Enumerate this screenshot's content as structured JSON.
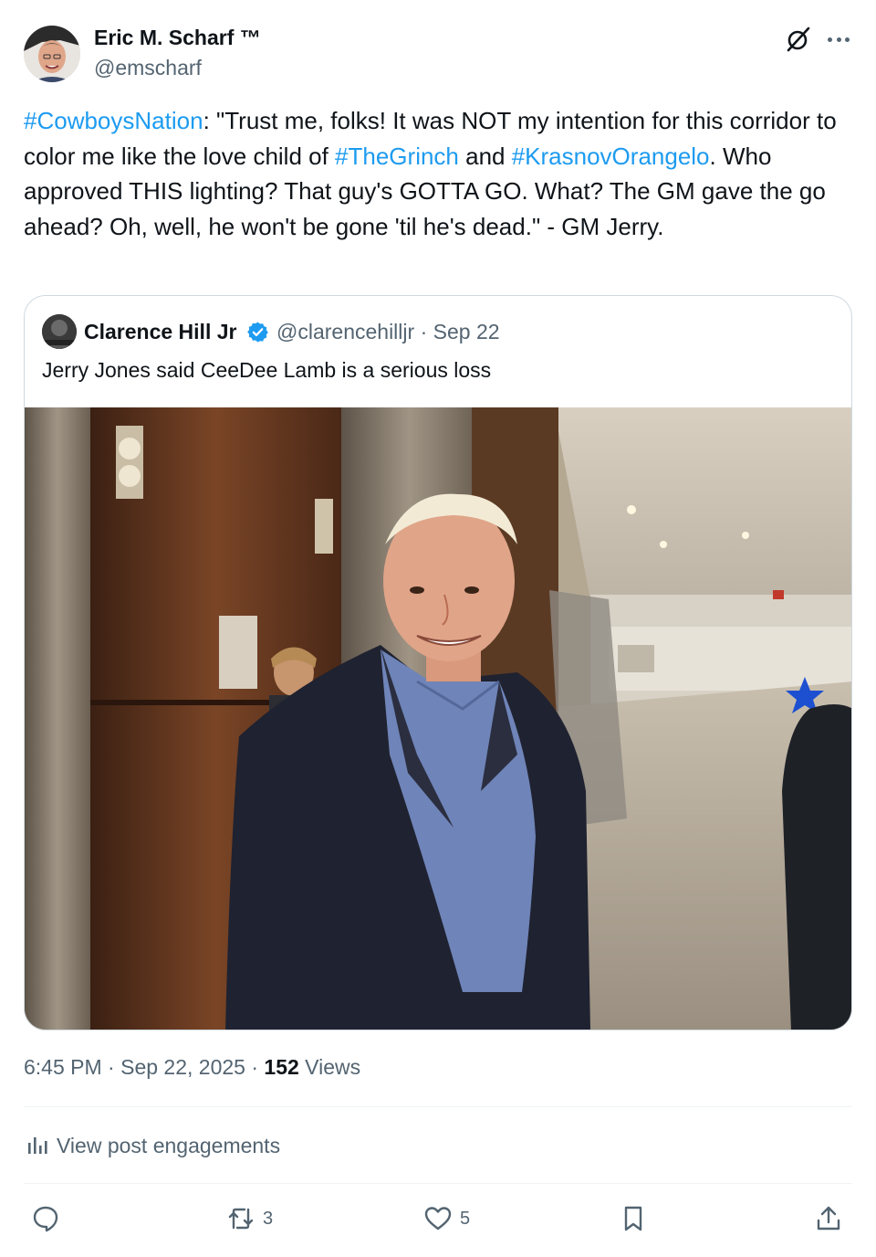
{
  "author": {
    "name": "Eric M. Scharf ™",
    "handle": "@emscharf",
    "icons": {
      "grok": "grok-slash-icon",
      "more": "more-dots-icon"
    }
  },
  "tweet": {
    "segments": [
      {
        "text": "#CowboysNation",
        "tag": true
      },
      {
        "text": ": \"Trust me, folks! It was NOT my intention for this corridor to color me like the love child of ",
        "tag": false
      },
      {
        "text": "#TheGrinch",
        "tag": true
      },
      {
        "text": " and ",
        "tag": false
      },
      {
        "text": "#KrasnovOrangelo",
        "tag": true
      },
      {
        "text": ". Who approved THIS lighting? That guy's GOTTA GO. What? The GM gave the go ahead? Oh, well, he won't be gone 'til he's dead.\" - GM Jerry.",
        "tag": false
      }
    ]
  },
  "quoted": {
    "name": "Clarence Hill Jr",
    "handle": "@clarencehilljr",
    "separator": "·",
    "date": "Sep 22",
    "text": "Jerry Jones said CeeDee Lamb is a serious loss",
    "verified_icon": "verified-badge-icon",
    "image": "photo of a smiling older man in a navy blazer and blue shirt standing in a lobby by wood-paneled elevators"
  },
  "meta": {
    "time": "6:45 PM",
    "sep1": "·",
    "date": "Sep 22, 2025",
    "sep2": "·",
    "views_count": "152",
    "views_label": "Views"
  },
  "engagements": {
    "label": "View post engagements",
    "icon": "analytics-icon"
  },
  "actions": {
    "reply": {
      "icon": "reply-icon",
      "count": ""
    },
    "repost": {
      "icon": "repost-icon",
      "count": "3"
    },
    "like": {
      "icon": "heart-icon",
      "count": "5"
    },
    "bookmark": {
      "icon": "bookmark-icon",
      "count": ""
    },
    "share": {
      "icon": "share-icon",
      "count": ""
    }
  },
  "colors": {
    "link": "#1d9bf0",
    "secondary": "#536471",
    "text": "#0f1419",
    "border": "#cfd9de"
  }
}
